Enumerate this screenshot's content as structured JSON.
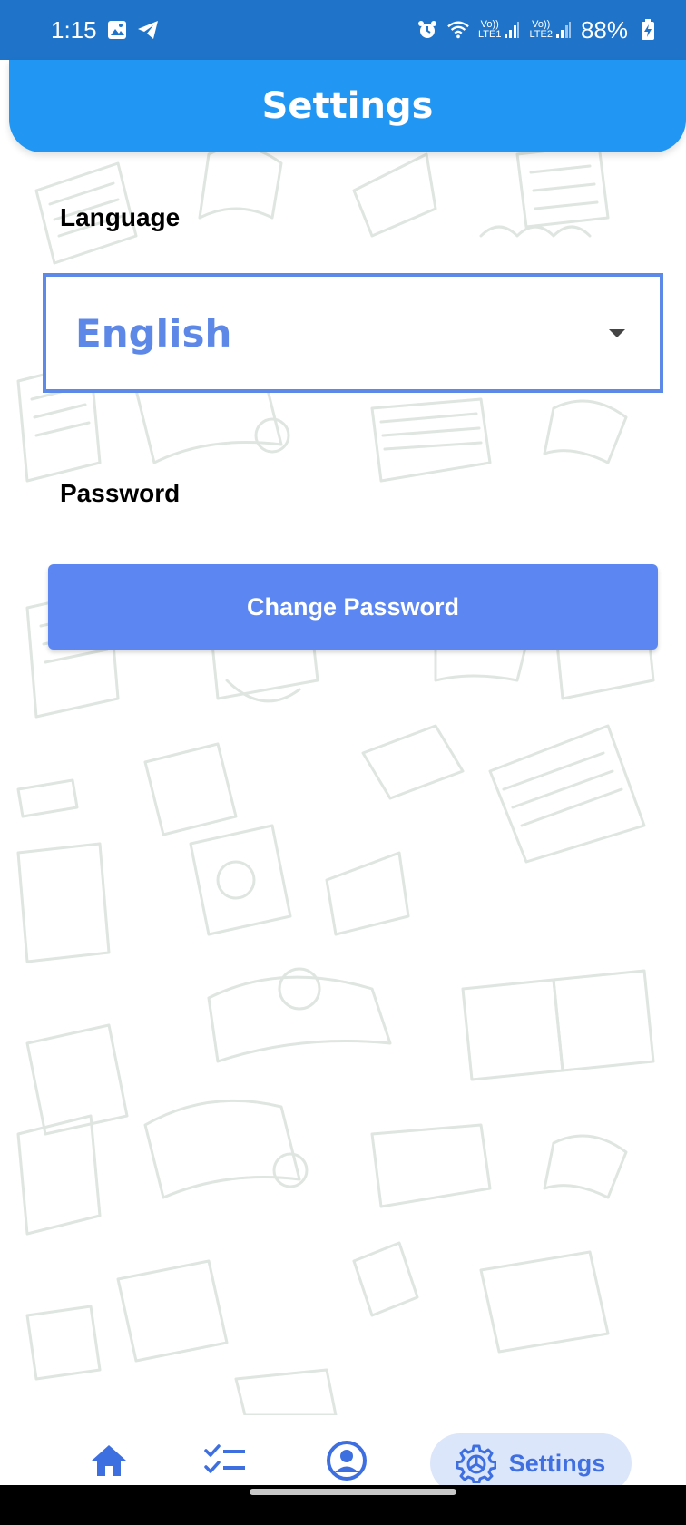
{
  "status_bar": {
    "time": "1:15",
    "net_label_1": "Vo))",
    "net_sub_1": "LTE1",
    "net_label_2": "Vo))",
    "net_sub_2": "LTE2",
    "battery": "88%"
  },
  "header": {
    "title": "Settings"
  },
  "language": {
    "label": "Language",
    "selected": "English"
  },
  "password": {
    "label": "Password",
    "button_label": "Change Password"
  },
  "bottom_nav": {
    "active_label": "Settings"
  },
  "colors": {
    "status_bar": "#1f74c9",
    "header": "#2196f3",
    "accent": "#5c87f2",
    "active_pill": "#dce6fb"
  }
}
